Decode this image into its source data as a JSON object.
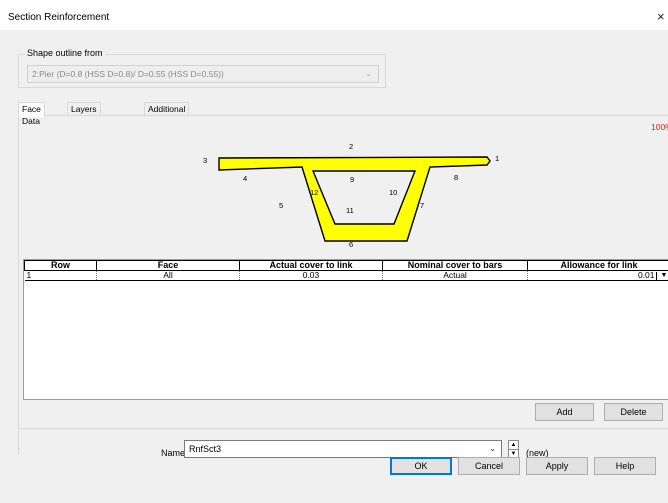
{
  "window": {
    "title": "Section Reinforcement",
    "close_glyph": "×"
  },
  "shape_outline": {
    "label": "Shape outline from",
    "value": "2:Pier (D=0.8 (HSS D=0.8)/ D=0.55 (HSS D=0.55))"
  },
  "tabs": [
    {
      "label": "Face Data",
      "active": true
    },
    {
      "label": "Layers of rebar",
      "active": false
    },
    {
      "label": "Additional bars",
      "active": false
    }
  ],
  "scale_text": "100%",
  "diagram": {
    "fill_color": "#ffff00",
    "edge_labels": [
      "1",
      "2",
      "3",
      "4",
      "5",
      "6",
      "7",
      "8",
      "9",
      "10",
      "11",
      "12"
    ]
  },
  "table": {
    "columns": [
      "Row",
      "Face",
      "Actual cover to link",
      "Nominal cover to bars",
      "Allowance for link"
    ],
    "rows": [
      {
        "row": "1",
        "face": "All",
        "actual_cover": "0.03",
        "nominal_cover": "Actual",
        "allowance": "0.01"
      }
    ]
  },
  "buttons": {
    "add": "Add",
    "delete": "Delete",
    "ok": "OK",
    "cancel": "Cancel",
    "apply": "Apply",
    "help": "Help"
  },
  "name_field": {
    "label": "Name",
    "value": "RnfSct3",
    "status": "(new)"
  }
}
